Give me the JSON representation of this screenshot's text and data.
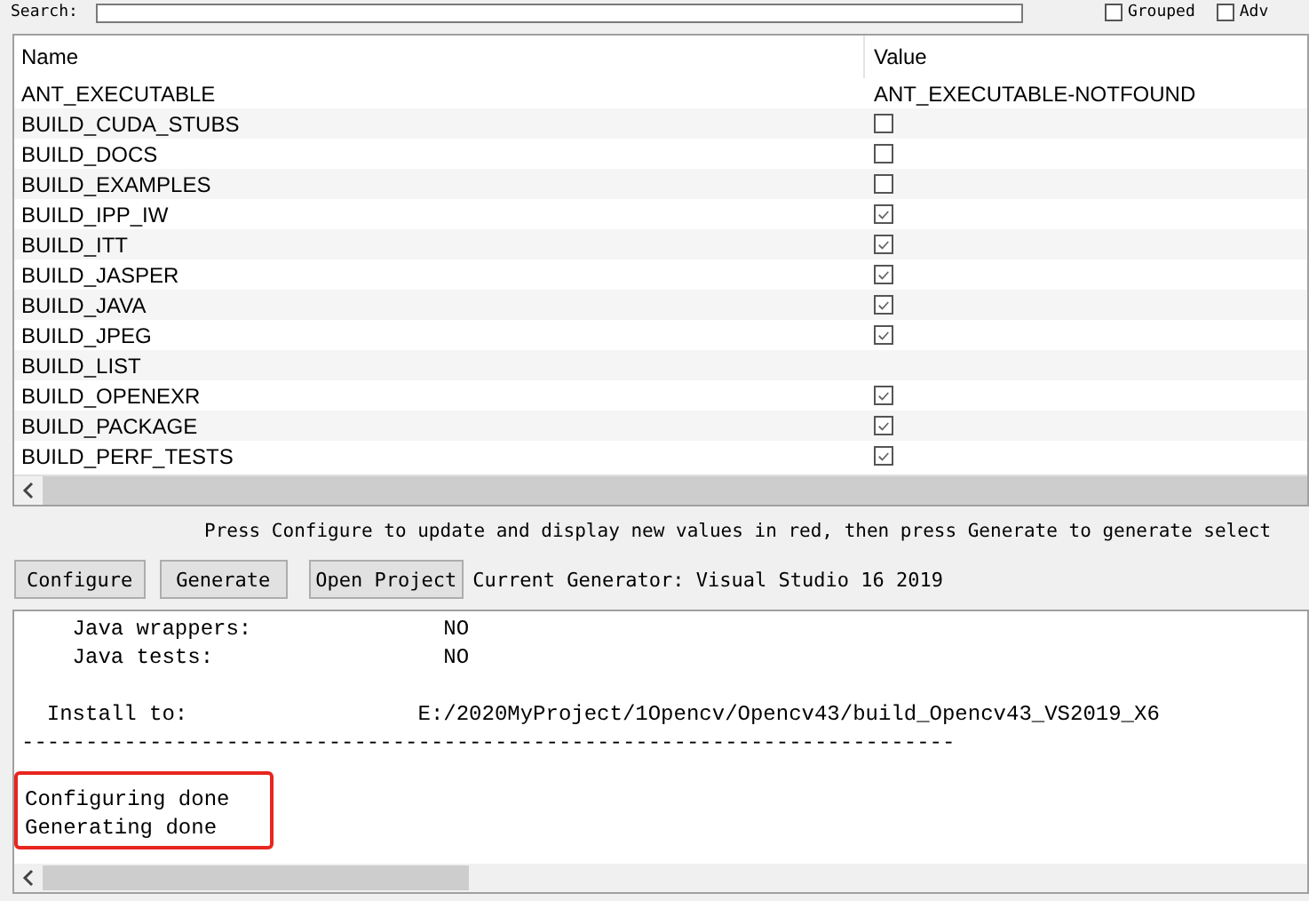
{
  "search": {
    "label": "Search:"
  },
  "options": [
    {
      "label": "Grouped",
      "checked": false
    },
    {
      "label": "Adv",
      "checked": false
    }
  ],
  "table": {
    "columns": [
      "Name",
      "Value"
    ],
    "rows": [
      {
        "name": "ANT_EXECUTABLE",
        "kind": "text",
        "value": "ANT_EXECUTABLE-NOTFOUND"
      },
      {
        "name": "BUILD_CUDA_STUBS",
        "kind": "checkbox",
        "checked": false
      },
      {
        "name": "BUILD_DOCS",
        "kind": "checkbox",
        "checked": false
      },
      {
        "name": "BUILD_EXAMPLES",
        "kind": "checkbox",
        "checked": false
      },
      {
        "name": "BUILD_IPP_IW",
        "kind": "checkbox",
        "checked": true
      },
      {
        "name": "BUILD_ITT",
        "kind": "checkbox",
        "checked": true
      },
      {
        "name": "BUILD_JASPER",
        "kind": "checkbox",
        "checked": true
      },
      {
        "name": "BUILD_JAVA",
        "kind": "checkbox",
        "checked": true
      },
      {
        "name": "BUILD_JPEG",
        "kind": "checkbox",
        "checked": true
      },
      {
        "name": "BUILD_LIST",
        "kind": "empty"
      },
      {
        "name": "BUILD_OPENEXR",
        "kind": "checkbox",
        "checked": true
      },
      {
        "name": "BUILD_PACKAGE",
        "kind": "checkbox",
        "checked": true
      },
      {
        "name": "BUILD_PERF_TESTS",
        "kind": "checkbox",
        "checked": true
      }
    ]
  },
  "hint": "Press Configure to update and display new values in red, then press Generate to generate select",
  "buttons": [
    "Configure",
    "Generate",
    "Open Project"
  ],
  "generator": "Current Generator: Visual Studio 16 2019",
  "log": {
    "blocks": [
      [
        "    Java wrappers:               NO",
        "    Java tests:                  NO"
      ],
      [
        "  Install to:                  E:/2020MyProject/1Opencv/Opencv43/build_Opencv43_VS2019_X6",
        "-------------------------------------------------------------------------"
      ]
    ],
    "highlighted_lines": [
      "Configuring done",
      "Generating done"
    ]
  }
}
